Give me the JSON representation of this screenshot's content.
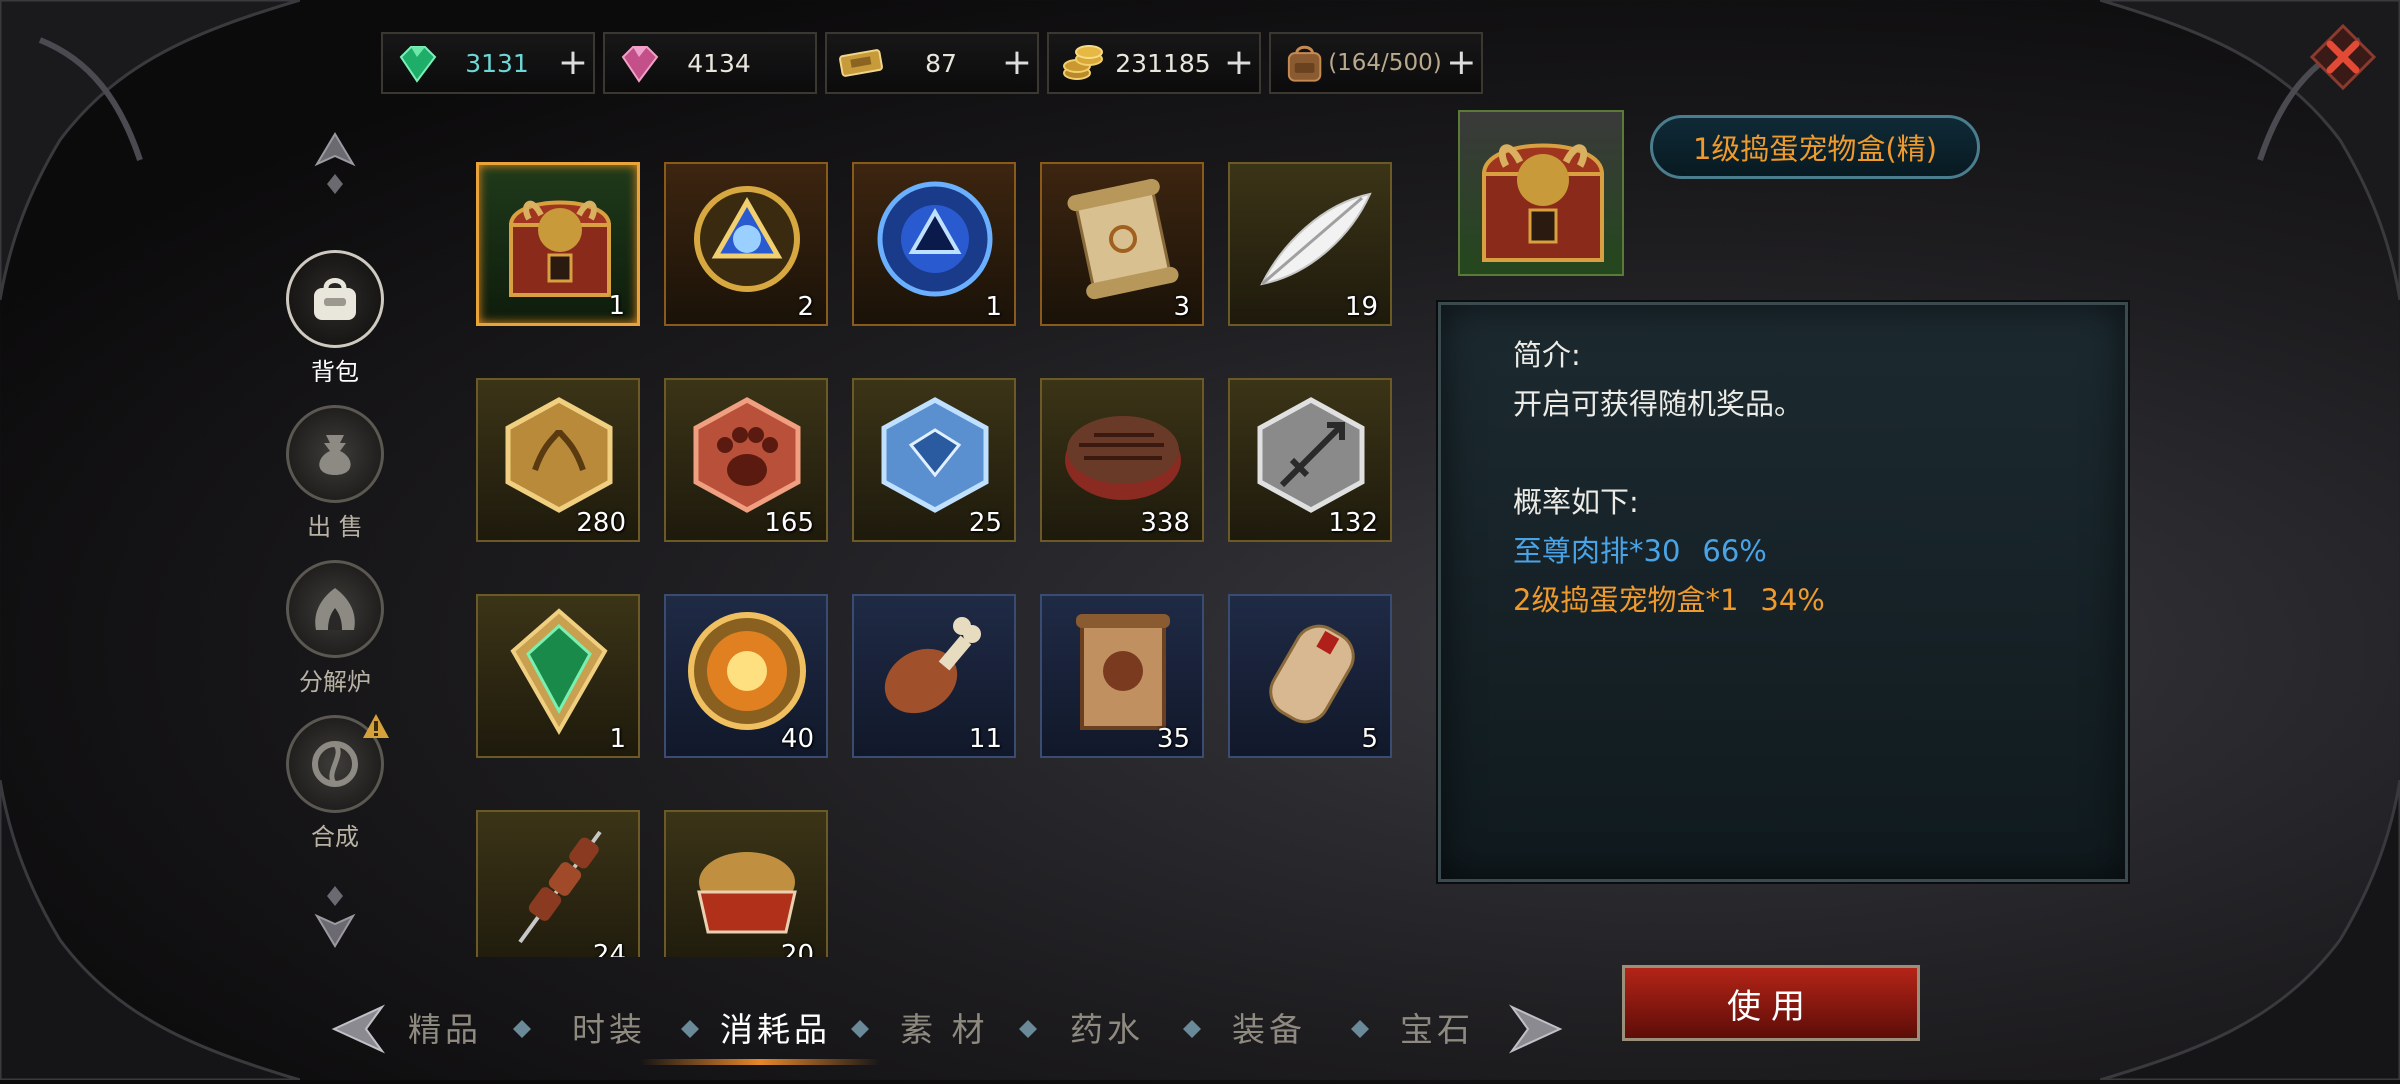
{
  "currency": [
    {
      "icon": "emerald-gem-icon",
      "value": "3131",
      "style": "teal"
    },
    {
      "icon": "pink-gem-icon",
      "value": "4134",
      "style": "normal"
    },
    {
      "icon": "ticket-icon",
      "value": "87",
      "style": "normal"
    },
    {
      "icon": "gold-coins-icon",
      "value": "231185",
      "style": "normal"
    },
    {
      "icon": "backpack-icon",
      "value": "(164/500)",
      "style": "muted"
    }
  ],
  "nav": [
    {
      "label": "背包",
      "icon": "bag-icon",
      "active": true
    },
    {
      "label": "出 售",
      "icon": "money-bag-icon",
      "active": false
    },
    {
      "label": "分解炉",
      "icon": "furnace-icon",
      "active": false
    },
    {
      "label": "合成",
      "icon": "synthesis-icon",
      "active": false,
      "alert": true
    }
  ],
  "items": [
    {
      "name": "egg-pet-box-lv1",
      "qty": "1",
      "rarity": "green",
      "selected": true
    },
    {
      "name": "golden-rune-amulet",
      "qty": "2",
      "rarity": "orange"
    },
    {
      "name": "blue-orb-rune",
      "qty": "1",
      "rarity": "orange"
    },
    {
      "name": "scroll",
      "qty": "3",
      "rarity": "orange"
    },
    {
      "name": "white-feather",
      "qty": "19",
      "rarity": "gold"
    },
    {
      "name": "gold-emblem-token",
      "qty": "280",
      "rarity": "gold"
    },
    {
      "name": "red-paw-token",
      "qty": "165",
      "rarity": "gold"
    },
    {
      "name": "blue-crystal-token",
      "qty": "25",
      "rarity": "gold"
    },
    {
      "name": "steak",
      "qty": "338",
      "rarity": "gold"
    },
    {
      "name": "silver-sword-token",
      "qty": "132",
      "rarity": "gold"
    },
    {
      "name": "green-crystal-shard",
      "qty": "1",
      "rarity": "gold"
    },
    {
      "name": "fire-medallion",
      "qty": "40",
      "rarity": "blue"
    },
    {
      "name": "drumstick",
      "qty": "11",
      "rarity": "blue"
    },
    {
      "name": "map-pack",
      "qty": "35",
      "rarity": "blue"
    },
    {
      "name": "rolled-scroll",
      "qty": "5",
      "rarity": "blue"
    },
    {
      "name": "meat-skewer",
      "qty": "24",
      "rarity": "gold"
    },
    {
      "name": "pet-food-bowl",
      "qty": "20",
      "rarity": "gold"
    }
  ],
  "detail": {
    "title": "1级捣蛋宠物盒(精)",
    "intro_label": "简介:",
    "intro_text": "开启可获得随机奖品。",
    "prob_label": "概率如下:",
    "drops": [
      {
        "text": "至尊肉排*30",
        "pct": "66%",
        "color": "blue"
      },
      {
        "text": "2级捣蛋宠物盒*1",
        "pct": "34%",
        "color": "orange"
      }
    ]
  },
  "use_button": "使用",
  "tabs": [
    "精品",
    "时装",
    "消耗品",
    "素 材",
    "药水",
    "装备",
    "宝石"
  ],
  "active_tab": "消耗品",
  "colors": {
    "accent_orange": "#ef9a2d",
    "accent_blue": "#4aa3e6",
    "use_red": "#b42417"
  }
}
